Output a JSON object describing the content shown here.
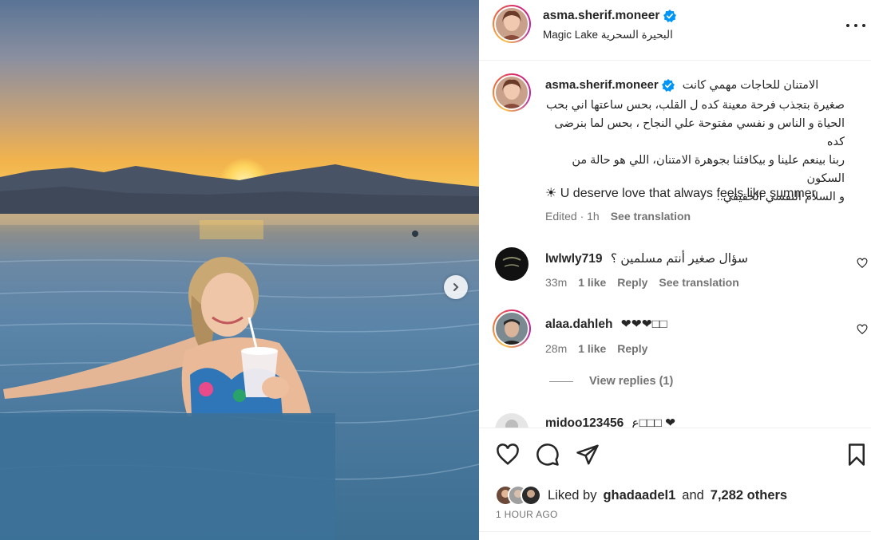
{
  "post": {
    "username": "asma.sherif.moneer",
    "location": "Magic Lake البحيرة السحرية"
  },
  "caption": {
    "username": "asma.sherif.moneer",
    "text_ar": "الامتنان للحاجات مهمي كانت\nصغيرة بتجذب فرحة معينة كده ل القلب، بحس ساعتها اني بحب\nالحياة و الناس و نفسي مفتوحة علي النجاح ، بحس لما بنرضى كده\nربنا بينعم علينا و بيكافئنا بجوهرة الامتنان، اللي هو حالة من السكون\nو السلام النفسي الحقيقي..",
    "text_en": "☀ U deserve love that always feels like summer",
    "edited_time": "Edited · 1h",
    "see_translation": "See translation"
  },
  "comments": [
    {
      "username": "lwlwly719",
      "text": "سؤال صغير أنتم مسلمين ؟",
      "time": "33m",
      "likes": "1 like",
      "reply": "Reply",
      "see_translation": "See translation"
    },
    {
      "username": "alaa.dahleh",
      "text": "❤❤❤□□",
      "time": "28m",
      "likes": "1 like",
      "reply": "Reply"
    },
    {
      "username": "midoo123456",
      "text": "ع□□□ ❤"
    }
  ],
  "view_replies": "View replies (1)",
  "actions": {
    "liked_prefix": "Liked by",
    "liked_user": "ghadaadel1",
    "liked_and": "and",
    "liked_others": "7,282 others",
    "time_ago": "1 HOUR AGO"
  },
  "icons": {
    "heart": "heart-icon",
    "comment": "comment-icon",
    "share": "share-icon",
    "save": "bookmark-icon",
    "more": "more-icon",
    "next": "chevron-right-icon",
    "verified": "verified-badge-icon"
  },
  "colors": {
    "verified_blue": "#0095f6",
    "meta_gray": "#737373",
    "text": "#262626"
  }
}
